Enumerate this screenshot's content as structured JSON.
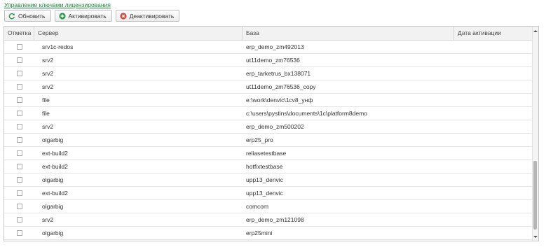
{
  "title": "Управление ключами лицензирования",
  "toolbar": {
    "refresh": {
      "label": "Обновить",
      "icon": "refresh-icon",
      "color": "#2e9a4b"
    },
    "activate": {
      "label": "Активировать",
      "icon": "plus-circle-icon",
      "color": "#2e9a4b"
    },
    "deactivate": {
      "label": "Деактивировать",
      "icon": "x-circle-icon",
      "color": "#d9453a"
    }
  },
  "table": {
    "columns": {
      "mark": "Отметка",
      "server": "Сервер",
      "base": "База",
      "activation_date": "Дата активации"
    },
    "rows": [
      {
        "server": "srv1c-redos",
        "base": "erp_demo_zm492013",
        "activation_date": "",
        "checked": false
      },
      {
        "server": "srv2",
        "base": "ut11demo_zm76536",
        "activation_date": "",
        "checked": false
      },
      {
        "server": "srv2",
        "base": "erp_tarketrus_bx138071",
        "activation_date": "",
        "checked": false
      },
      {
        "server": "srv2",
        "base": "ut11demo_zm76536_copy",
        "activation_date": "",
        "checked": false
      },
      {
        "server": "file",
        "base": "e:\\work\\denvic\\1cv8_унф",
        "activation_date": "",
        "checked": false
      },
      {
        "server": "file",
        "base": "c:\\users\\pystins\\documents\\1c\\platform8demo",
        "activation_date": "",
        "checked": false
      },
      {
        "server": "srv2",
        "base": "erp_demo_zm500202",
        "activation_date": "",
        "checked": false
      },
      {
        "server": "olgarbig",
        "base": "erp25_pro",
        "activation_date": "",
        "checked": false
      },
      {
        "server": "ext-build2",
        "base": "reliasetestbase",
        "activation_date": "",
        "checked": false
      },
      {
        "server": "ext-build2",
        "base": "hotfixtestbase",
        "activation_date": "",
        "checked": false
      },
      {
        "server": "olgarbig",
        "base": "upp13_denvic",
        "activation_date": "",
        "checked": false
      },
      {
        "server": "ext-build2",
        "base": "upp13_denvic",
        "activation_date": "",
        "checked": false
      },
      {
        "server": "olgarbig",
        "base": "comcom",
        "activation_date": "",
        "checked": false
      },
      {
        "server": "srv2",
        "base": "erp_demo_zm121098",
        "activation_date": "",
        "checked": false
      },
      {
        "server": "olgarbig",
        "base": "erp25mini",
        "activation_date": "",
        "checked": false
      }
    ]
  }
}
